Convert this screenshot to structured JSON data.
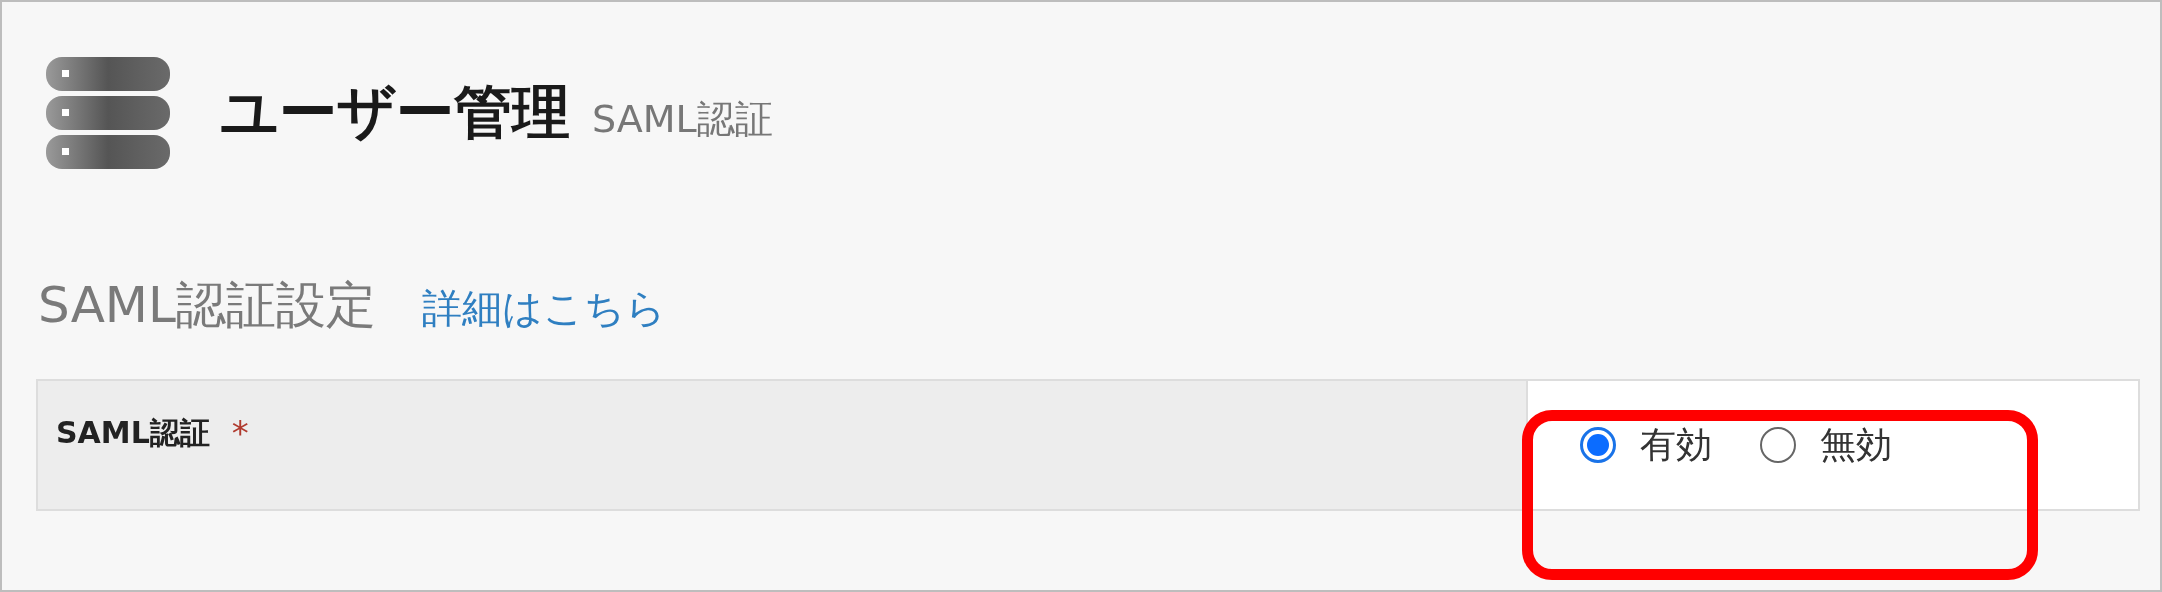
{
  "header": {
    "title": "ユーザー管理",
    "subtitle": "SAML認証"
  },
  "section": {
    "heading": "SAML認証設定",
    "link": "詳細はこちら"
  },
  "form": {
    "rows": [
      {
        "label": "SAML認証",
        "required_mark": "*",
        "options": [
          {
            "label": "有効",
            "selected": true
          },
          {
            "label": "無効",
            "selected": false
          }
        ]
      }
    ]
  }
}
